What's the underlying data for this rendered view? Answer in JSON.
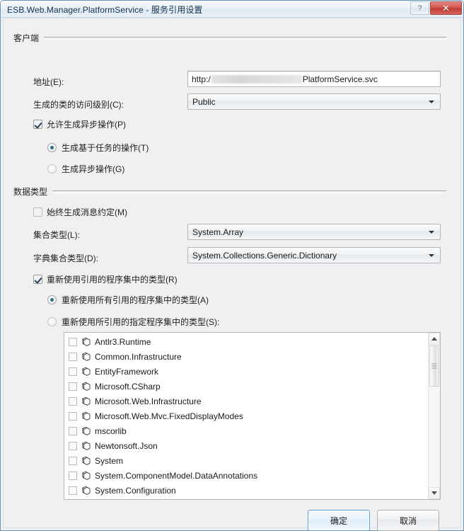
{
  "window": {
    "title": "ESB.Web.Manager.PlatformService - 服务引用设置",
    "help_button": "?",
    "close_button": "✕"
  },
  "client_group": {
    "header": "客户端",
    "address_label": "地址(E):",
    "address_prefix": "http:/",
    "address_suffix": "PlatformService.svc",
    "access_label": "生成的类的访问级别(C):",
    "access_value": "Public",
    "async_checkbox_label": "允许生成异步操作(P)",
    "async_checkbox_checked": true,
    "task_based_radio_label": "生成基于任务的操作(T)",
    "task_based_selected": true,
    "async_radio_label": "生成异步操作(G)",
    "async_selected": false
  },
  "data_type_group": {
    "header": "数据类型",
    "message_contract_label": "始终生成消息约定(M)",
    "message_contract_checked": false,
    "collection_label": "集合类型(L):",
    "collection_value": "System.Array",
    "dictionary_label": "字典集合类型(D):",
    "dictionary_value": "System.Collections.Generic.Dictionary",
    "reuse_checkbox_label": "重新使用引用的程序集中的类型(R)",
    "reuse_checkbox_checked": true,
    "reuse_all_radio_label": "重新使用所有引用的程序集中的类型(A)",
    "reuse_all_selected": true,
    "reuse_specified_radio_label": "重新使用所引用的指定程序集中的类型(S):",
    "reuse_specified_selected": false,
    "assemblies": [
      {
        "name": "Antlr3.Runtime",
        "checked": false
      },
      {
        "name": "Common.Infrastructure",
        "checked": false
      },
      {
        "name": "EntityFramework",
        "checked": false
      },
      {
        "name": "Microsoft.CSharp",
        "checked": false
      },
      {
        "name": "Microsoft.Web.Infrastructure",
        "checked": false
      },
      {
        "name": "Microsoft.Web.Mvc.FixedDisplayModes",
        "checked": false
      },
      {
        "name": "mscorlib",
        "checked": false
      },
      {
        "name": "Newtonsoft.Json",
        "checked": false
      },
      {
        "name": "System",
        "checked": false
      },
      {
        "name": "System.ComponentModel.DataAnnotations",
        "checked": false
      },
      {
        "name": "System.Configuration",
        "checked": false
      }
    ]
  },
  "footer": {
    "ok_label": "确定",
    "cancel_label": "取消"
  },
  "colors": {
    "dialog_background": "#f0f0f0",
    "titlebar_border": "#6d94b5",
    "close_button_red": "#c13b35",
    "default_button_border": "#5b9dd9",
    "radio_dot": "#2f6e7e"
  }
}
